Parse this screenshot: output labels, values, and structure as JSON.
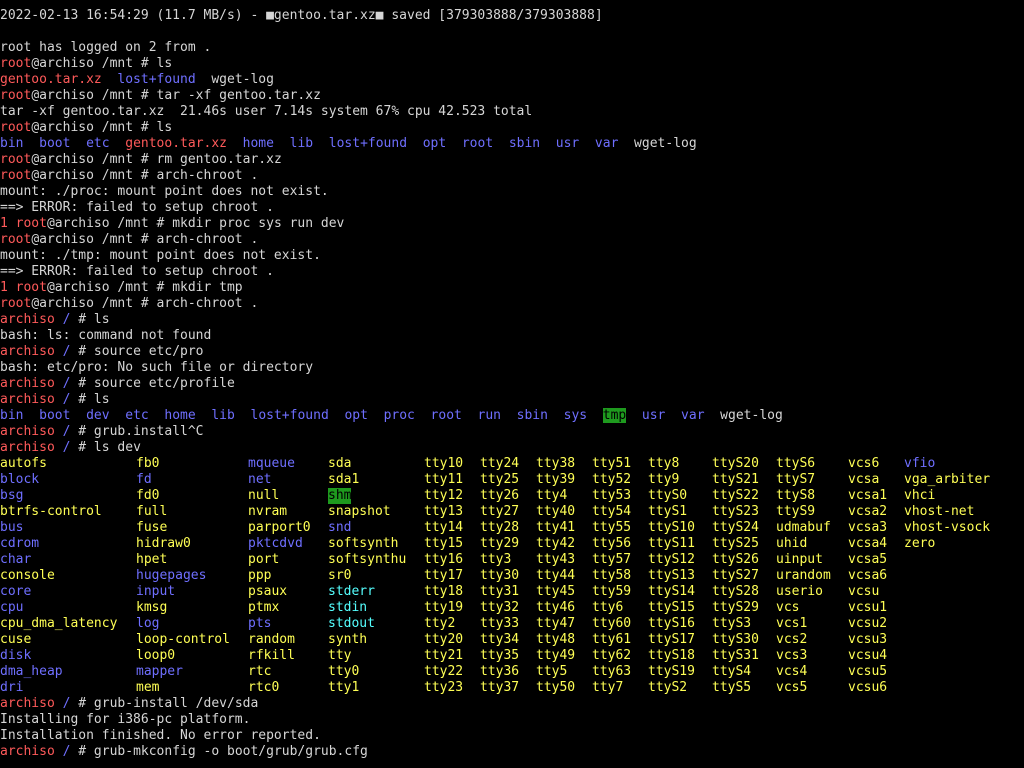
{
  "colors": {
    "default": "#d6d6d6",
    "red": "#ff5a5a",
    "blue": "#6f6fff",
    "yellow": "#ffff55",
    "white": "#ffffff",
    "cyan": "#55ffff",
    "green_highlight": "#1e9a1e",
    "background": "#000000"
  },
  "lines": [
    [
      [
        "default",
        "2022-02-13 16:54:29 (11.7 MB/s) - ■gentoo.tar.xz■ saved [379303888/379303888]"
      ]
    ],
    [
      [
        "default",
        ""
      ]
    ],
    [
      [
        "default",
        "root has logged on 2 from ."
      ]
    ],
    [
      [
        "red",
        "root"
      ],
      [
        "default",
        "@archiso /mnt # ls"
      ]
    ],
    [
      [
        "red",
        "gentoo.tar.xz"
      ],
      [
        "default",
        "  "
      ],
      [
        "blue",
        "lost+found"
      ],
      [
        "default",
        "  wget-log"
      ]
    ],
    [
      [
        "red",
        "root"
      ],
      [
        "default",
        "@archiso /mnt # tar -xf gentoo.tar.xz"
      ]
    ],
    [
      [
        "default",
        "tar -xf gentoo.tar.xz  21.46s user 7.14s system 67% cpu 42.523 total"
      ]
    ],
    [
      [
        "red",
        "root"
      ],
      [
        "default",
        "@archiso /mnt # ls"
      ]
    ],
    [
      [
        "blue",
        "bin"
      ],
      [
        "default",
        "  "
      ],
      [
        "blue",
        "boot"
      ],
      [
        "default",
        "  "
      ],
      [
        "blue",
        "etc"
      ],
      [
        "default",
        "  "
      ],
      [
        "red",
        "gentoo.tar.xz"
      ],
      [
        "default",
        "  "
      ],
      [
        "blue",
        "home"
      ],
      [
        "default",
        "  "
      ],
      [
        "blue",
        "lib"
      ],
      [
        "default",
        "  "
      ],
      [
        "blue",
        "lost+found"
      ],
      [
        "default",
        "  "
      ],
      [
        "blue",
        "opt"
      ],
      [
        "default",
        "  "
      ],
      [
        "blue",
        "root"
      ],
      [
        "default",
        "  "
      ],
      [
        "blue",
        "sbin"
      ],
      [
        "default",
        "  "
      ],
      [
        "blue",
        "usr"
      ],
      [
        "default",
        "  "
      ],
      [
        "blue",
        "var"
      ],
      [
        "default",
        "  wget-log"
      ]
    ],
    [
      [
        "red",
        "root"
      ],
      [
        "default",
        "@archiso /mnt # rm gentoo.tar.xz"
      ]
    ],
    [
      [
        "red",
        "root"
      ],
      [
        "default",
        "@archiso /mnt # arch-chroot ."
      ]
    ],
    [
      [
        "default",
        "mount: ./proc: mount point does not exist."
      ]
    ],
    [
      [
        "default",
        "==> ERROR: failed to setup chroot ."
      ]
    ],
    [
      [
        "red",
        "1 root"
      ],
      [
        "default",
        "@archiso /mnt # mkdir proc sys run dev"
      ]
    ],
    [
      [
        "red",
        "root"
      ],
      [
        "default",
        "@archiso /mnt # arch-chroot ."
      ]
    ],
    [
      [
        "default",
        "mount: ./tmp: mount point does not exist."
      ]
    ],
    [
      [
        "default",
        "==> ERROR: failed to setup chroot ."
      ]
    ],
    [
      [
        "red",
        "1 root"
      ],
      [
        "default",
        "@archiso /mnt # mkdir tmp"
      ]
    ],
    [
      [
        "red",
        "root"
      ],
      [
        "default",
        "@archiso /mnt # arch-chroot ."
      ]
    ],
    [
      [
        "red",
        "archiso"
      ],
      [
        "blue",
        " / "
      ],
      [
        "default",
        "# ls"
      ]
    ],
    [
      [
        "default",
        "bash: ls: command not found"
      ]
    ],
    [
      [
        "red",
        "archiso"
      ],
      [
        "blue",
        " / "
      ],
      [
        "default",
        "# source etc/pro"
      ]
    ],
    [
      [
        "default",
        "bash: etc/pro: No such file or directory"
      ]
    ],
    [
      [
        "red",
        "archiso"
      ],
      [
        "blue",
        " / "
      ],
      [
        "default",
        "# source etc/profile"
      ]
    ],
    [
      [
        "red",
        "archiso"
      ],
      [
        "blue",
        " / "
      ],
      [
        "default",
        "# ls"
      ]
    ],
    [
      [
        "blue",
        "bin"
      ],
      [
        "default",
        "  "
      ],
      [
        "blue",
        "boot"
      ],
      [
        "default",
        "  "
      ],
      [
        "blue",
        "dev"
      ],
      [
        "default",
        "  "
      ],
      [
        "blue",
        "etc"
      ],
      [
        "default",
        "  "
      ],
      [
        "blue",
        "home"
      ],
      [
        "default",
        "  "
      ],
      [
        "blue",
        "lib"
      ],
      [
        "default",
        "  "
      ],
      [
        "blue",
        "lost+found"
      ],
      [
        "default",
        "  "
      ],
      [
        "blue",
        "opt"
      ],
      [
        "default",
        "  "
      ],
      [
        "blue",
        "proc"
      ],
      [
        "default",
        "  "
      ],
      [
        "blue",
        "root"
      ],
      [
        "default",
        "  "
      ],
      [
        "blue",
        "run"
      ],
      [
        "default",
        "  "
      ],
      [
        "blue",
        "sbin"
      ],
      [
        "default",
        "  "
      ],
      [
        "blue",
        "sys"
      ],
      [
        "default",
        "  "
      ],
      [
        "hl",
        "tmp"
      ],
      [
        "default",
        "  "
      ],
      [
        "blue",
        "usr"
      ],
      [
        "default",
        "  "
      ],
      [
        "blue",
        "var"
      ],
      [
        "default",
        "  wget-log"
      ]
    ],
    [
      [
        "red",
        "archiso"
      ],
      [
        "blue",
        " / "
      ],
      [
        "default",
        "# grub.install^C"
      ]
    ],
    [
      [
        "red",
        "archiso"
      ],
      [
        "blue",
        " / "
      ],
      [
        "default",
        "# ls dev"
      ]
    ]
  ],
  "dev_columns": [
    [
      [
        "yellow",
        "autofs"
      ],
      [
        "blue",
        "block"
      ],
      [
        "blue",
        "bsg"
      ],
      [
        "yellow",
        "btrfs-control"
      ],
      [
        "blue",
        "bus"
      ],
      [
        "blue",
        "cdrom"
      ],
      [
        "blue",
        "char"
      ],
      [
        "yellow",
        "console"
      ],
      [
        "blue",
        "core"
      ],
      [
        "blue",
        "cpu"
      ],
      [
        "yellow",
        "cpu_dma_latency"
      ],
      [
        "yellow",
        "cuse"
      ],
      [
        "blue",
        "disk"
      ],
      [
        "blue",
        "dma_heap"
      ],
      [
        "blue",
        "dri"
      ]
    ],
    [
      [
        "yellow",
        "fb0"
      ],
      [
        "blue",
        "fd"
      ],
      [
        "yellow",
        "fd0"
      ],
      [
        "yellow",
        "full"
      ],
      [
        "yellow",
        "fuse"
      ],
      [
        "yellow",
        "hidraw0"
      ],
      [
        "yellow",
        "hpet"
      ],
      [
        "blue",
        "hugepages"
      ],
      [
        "blue",
        "input"
      ],
      [
        "yellow",
        "kmsg"
      ],
      [
        "blue",
        "log"
      ],
      [
        "yellow",
        "loop-control"
      ],
      [
        "yellow",
        "loop0"
      ],
      [
        "blue",
        "mapper"
      ],
      [
        "yellow",
        "mem"
      ]
    ],
    [
      [
        "blue",
        "mqueue"
      ],
      [
        "blue",
        "net"
      ],
      [
        "yellow",
        "null"
      ],
      [
        "yellow",
        "nvram"
      ],
      [
        "yellow",
        "parport0"
      ],
      [
        "blue",
        "pktcdvd"
      ],
      [
        "yellow",
        "port"
      ],
      [
        "yellow",
        "ppp"
      ],
      [
        "yellow",
        "psaux"
      ],
      [
        "yellow",
        "ptmx"
      ],
      [
        "blue",
        "pts"
      ],
      [
        "yellow",
        "random"
      ],
      [
        "yellow",
        "rfkill"
      ],
      [
        "yellow",
        "rtc"
      ],
      [
        "yellow",
        "rtc0"
      ]
    ],
    [
      [
        "yellow",
        "sda"
      ],
      [
        "yellow",
        "sda1"
      ],
      [
        "hl",
        "shm"
      ],
      [
        "yellow",
        "snapshot"
      ],
      [
        "blue",
        "snd"
      ],
      [
        "yellow",
        "softsynth"
      ],
      [
        "yellow",
        "softsynthu"
      ],
      [
        "yellow",
        "sr0"
      ],
      [
        "cyan",
        "stderr"
      ],
      [
        "cyan",
        "stdin"
      ],
      [
        "cyan",
        "stdout"
      ],
      [
        "yellow",
        "synth"
      ],
      [
        "yellow",
        "tty"
      ],
      [
        "yellow",
        "tty0"
      ],
      [
        "yellow",
        "tty1"
      ]
    ],
    [
      [
        "yellow",
        "tty10"
      ],
      [
        "yellow",
        "tty11"
      ],
      [
        "yellow",
        "tty12"
      ],
      [
        "yellow",
        "tty13"
      ],
      [
        "yellow",
        "tty14"
      ],
      [
        "yellow",
        "tty15"
      ],
      [
        "yellow",
        "tty16"
      ],
      [
        "yellow",
        "tty17"
      ],
      [
        "yellow",
        "tty18"
      ],
      [
        "yellow",
        "tty19"
      ],
      [
        "yellow",
        "tty2"
      ],
      [
        "yellow",
        "tty20"
      ],
      [
        "yellow",
        "tty21"
      ],
      [
        "yellow",
        "tty22"
      ],
      [
        "yellow",
        "tty23"
      ]
    ],
    [
      [
        "yellow",
        "tty24"
      ],
      [
        "yellow",
        "tty25"
      ],
      [
        "yellow",
        "tty26"
      ],
      [
        "yellow",
        "tty27"
      ],
      [
        "yellow",
        "tty28"
      ],
      [
        "yellow",
        "tty29"
      ],
      [
        "yellow",
        "tty3"
      ],
      [
        "yellow",
        "tty30"
      ],
      [
        "yellow",
        "tty31"
      ],
      [
        "yellow",
        "tty32"
      ],
      [
        "yellow",
        "tty33"
      ],
      [
        "yellow",
        "tty34"
      ],
      [
        "yellow",
        "tty35"
      ],
      [
        "yellow",
        "tty36"
      ],
      [
        "yellow",
        "tty37"
      ]
    ],
    [
      [
        "yellow",
        "tty38"
      ],
      [
        "yellow",
        "tty39"
      ],
      [
        "yellow",
        "tty4"
      ],
      [
        "yellow",
        "tty40"
      ],
      [
        "yellow",
        "tty41"
      ],
      [
        "yellow",
        "tty42"
      ],
      [
        "yellow",
        "tty43"
      ],
      [
        "yellow",
        "tty44"
      ],
      [
        "yellow",
        "tty45"
      ],
      [
        "yellow",
        "tty46"
      ],
      [
        "yellow",
        "tty47"
      ],
      [
        "yellow",
        "tty48"
      ],
      [
        "yellow",
        "tty49"
      ],
      [
        "yellow",
        "tty5"
      ],
      [
        "yellow",
        "tty50"
      ]
    ],
    [
      [
        "yellow",
        "tty51"
      ],
      [
        "yellow",
        "tty52"
      ],
      [
        "yellow",
        "tty53"
      ],
      [
        "yellow",
        "tty54"
      ],
      [
        "yellow",
        "tty55"
      ],
      [
        "yellow",
        "tty56"
      ],
      [
        "yellow",
        "tty57"
      ],
      [
        "yellow",
        "tty58"
      ],
      [
        "yellow",
        "tty59"
      ],
      [
        "yellow",
        "tty6"
      ],
      [
        "yellow",
        "tty60"
      ],
      [
        "yellow",
        "tty61"
      ],
      [
        "yellow",
        "tty62"
      ],
      [
        "yellow",
        "tty63"
      ],
      [
        "yellow",
        "tty7"
      ]
    ],
    [
      [
        "yellow",
        "tty8"
      ],
      [
        "yellow",
        "tty9"
      ],
      [
        "yellow",
        "ttyS0"
      ],
      [
        "yellow",
        "ttyS1"
      ],
      [
        "yellow",
        "ttyS10"
      ],
      [
        "yellow",
        "ttyS11"
      ],
      [
        "yellow",
        "ttyS12"
      ],
      [
        "yellow",
        "ttyS13"
      ],
      [
        "yellow",
        "ttyS14"
      ],
      [
        "yellow",
        "ttyS15"
      ],
      [
        "yellow",
        "ttyS16"
      ],
      [
        "yellow",
        "ttyS17"
      ],
      [
        "yellow",
        "ttyS18"
      ],
      [
        "yellow",
        "ttyS19"
      ],
      [
        "yellow",
        "ttyS2"
      ]
    ],
    [
      [
        "yellow",
        "ttyS20"
      ],
      [
        "yellow",
        "ttyS21"
      ],
      [
        "yellow",
        "ttyS22"
      ],
      [
        "yellow",
        "ttyS23"
      ],
      [
        "yellow",
        "ttyS24"
      ],
      [
        "yellow",
        "ttyS25"
      ],
      [
        "yellow",
        "ttyS26"
      ],
      [
        "yellow",
        "ttyS27"
      ],
      [
        "yellow",
        "ttyS28"
      ],
      [
        "yellow",
        "ttyS29"
      ],
      [
        "yellow",
        "ttyS3"
      ],
      [
        "yellow",
        "ttyS30"
      ],
      [
        "yellow",
        "ttyS31"
      ],
      [
        "yellow",
        "ttyS4"
      ],
      [
        "yellow",
        "ttyS5"
      ]
    ],
    [
      [
        "yellow",
        "ttyS6"
      ],
      [
        "yellow",
        "ttyS7"
      ],
      [
        "yellow",
        "ttyS8"
      ],
      [
        "yellow",
        "ttyS9"
      ],
      [
        "yellow",
        "udmabuf"
      ],
      [
        "yellow",
        "uhid"
      ],
      [
        "yellow",
        "uinput"
      ],
      [
        "yellow",
        "urandom"
      ],
      [
        "yellow",
        "userio"
      ],
      [
        "yellow",
        "vcs"
      ],
      [
        "yellow",
        "vcs1"
      ],
      [
        "yellow",
        "vcs2"
      ],
      [
        "yellow",
        "vcs3"
      ],
      [
        "yellow",
        "vcs4"
      ],
      [
        "yellow",
        "vcs5"
      ]
    ],
    [
      [
        "yellow",
        "vcs6"
      ],
      [
        "yellow",
        "vcsa"
      ],
      [
        "yellow",
        "vcsa1"
      ],
      [
        "yellow",
        "vcsa2"
      ],
      [
        "yellow",
        "vcsa3"
      ],
      [
        "yellow",
        "vcsa4"
      ],
      [
        "yellow",
        "vcsa5"
      ],
      [
        "yellow",
        "vcsa6"
      ],
      [
        "yellow",
        "vcsu"
      ],
      [
        "yellow",
        "vcsu1"
      ],
      [
        "yellow",
        "vcsu2"
      ],
      [
        "yellow",
        "vcsu3"
      ],
      [
        "yellow",
        "vcsu4"
      ],
      [
        "yellow",
        "vcsu5"
      ],
      [
        "yellow",
        "vcsu6"
      ]
    ],
    [
      [
        "blue",
        "vfio"
      ],
      [
        "yellow",
        "vga_arbiter"
      ],
      [
        "yellow",
        "vhci"
      ],
      [
        "yellow",
        "vhost-net"
      ],
      [
        "yellow",
        "vhost-vsock"
      ],
      [
        "yellow",
        "zero"
      ]
    ]
  ],
  "tail_lines": [
    [
      [
        "red",
        "archiso"
      ],
      [
        "blue",
        " / "
      ],
      [
        "default",
        "# grub-install /dev/sda"
      ]
    ],
    [
      [
        "default",
        "Installing for i386-pc platform."
      ]
    ],
    [
      [
        "default",
        "Installation finished. No error reported."
      ]
    ],
    [
      [
        "red",
        "archiso"
      ],
      [
        "blue",
        " / "
      ],
      [
        "default",
        "# grub-mkconfig -o boot/grub/grub.cfg"
      ]
    ]
  ]
}
